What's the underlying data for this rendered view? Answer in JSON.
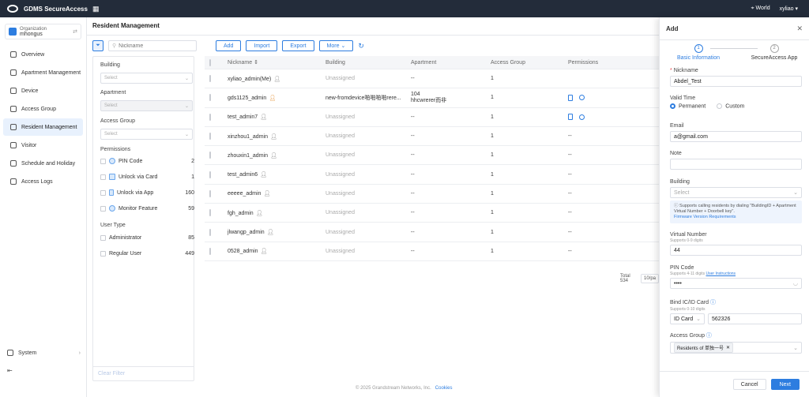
{
  "topbar": {
    "title": "GDMS SecureAccess",
    "region": "World",
    "user": "xyliao"
  },
  "sidebar": {
    "org_label": "Organization",
    "org_name": "mhongus",
    "items": [
      {
        "label": "Overview"
      },
      {
        "label": "Apartment Management"
      },
      {
        "label": "Device"
      },
      {
        "label": "Access Group"
      },
      {
        "label": "Resident Management"
      },
      {
        "label": "Visitor"
      },
      {
        "label": "Schedule and Holiday"
      },
      {
        "label": "Access Logs"
      }
    ],
    "system": "System"
  },
  "main": {
    "title": "Resident Management",
    "search_placeholder": "Nickname",
    "add": "Add",
    "import": "Import",
    "export": "Export",
    "more": "More"
  },
  "filter": {
    "building_label": "Building",
    "building_ph": "Select",
    "apartment_label": "Apartment",
    "apartment_ph": "Select",
    "access_group_label": "Access Group",
    "access_group_ph": "Select",
    "permissions_label": "Permissions",
    "permissions": [
      {
        "label": "PIN Code",
        "count": "2"
      },
      {
        "label": "Unlock via Card",
        "count": "1"
      },
      {
        "label": "Unlock via App",
        "count": "160"
      },
      {
        "label": "Monitor Feature",
        "count": "59"
      }
    ],
    "user_type_label": "User Type",
    "user_types": [
      {
        "label": "Administrator",
        "count": "85"
      },
      {
        "label": "Regular User",
        "count": "449"
      }
    ],
    "clear": "Clear Filter"
  },
  "table": {
    "headers": [
      "Nickname",
      "Building",
      "Apartment",
      "Access Group",
      "Permissions"
    ],
    "rows": [
      {
        "nick": "xyliao_admin(Me)",
        "building": "Unassigned",
        "apt": "--",
        "ag": "1",
        "perm": ""
      },
      {
        "nick": "gds1125_admin",
        "building": "new-fromdevice啪啪啪啪rere...",
        "apt": "104",
        "apt2": "hhcwrerer而非",
        "ag": "1",
        "perm": "icons"
      },
      {
        "nick": "test_admin7",
        "building": "Unassigned",
        "apt": "--",
        "ag": "1",
        "perm": "icons"
      },
      {
        "nick": "xinzhou1_admin",
        "building": "Unassigned",
        "apt": "--",
        "ag": "1",
        "perm": "--"
      },
      {
        "nick": "zhouxin1_admin",
        "building": "Unassigned",
        "apt": "--",
        "ag": "1",
        "perm": "--"
      },
      {
        "nick": "test_admin6",
        "building": "Unassigned",
        "apt": "--",
        "ag": "1",
        "perm": "--"
      },
      {
        "nick": "eeeee_admin",
        "building": "Unassigned",
        "apt": "--",
        "ag": "1",
        "perm": "--"
      },
      {
        "nick": "fgh_admin",
        "building": "Unassigned",
        "apt": "--",
        "ag": "1",
        "perm": "--"
      },
      {
        "nick": "jlwangp_admin",
        "building": "Unassigned",
        "apt": "--",
        "ag": "1",
        "perm": "--"
      },
      {
        "nick": "0528_admin",
        "building": "Unassigned",
        "apt": "--",
        "ag": "1",
        "perm": "--"
      }
    ],
    "total": "Total 534",
    "page_size": "10/pa"
  },
  "footer": {
    "copyright": "© 2025 Grandstream Networks, Inc.",
    "cookies": "Cookies"
  },
  "drawer": {
    "title": "Add",
    "step1": "Basic Information",
    "step2": "SecureAccess App",
    "nickname_label": "Nickname",
    "nickname": "Abdel_Test",
    "valid_label": "Valid Time",
    "permanent": "Permanent",
    "custom": "Custom",
    "email_label": "Email",
    "email": "a@gmail.com",
    "note_label": "Note",
    "building_label": "Building",
    "building_ph": "Select",
    "tip": "Supports calling residents by dialing \"BuildingID + Apartment Virtual Number + Doorbell key\".",
    "tip_link": "Firmware Version Requirements",
    "vn_label": "Virtual Number",
    "vn_sub": "Supports 0-9 digits",
    "vn": "44",
    "pin_label": "PIN Code",
    "pin_sub": "Supports 4-11 digits",
    "pin_link": "User Instructions",
    "pin": "••••",
    "card_label": "Bind IC/ID Card",
    "card_sub": "Supports 0-10 digits",
    "card_type": "ID Card",
    "card": "562326",
    "ag_label": "Access Group",
    "ag_tag": "Residents of 单独一号",
    "cancel": "Cancel",
    "next": "Next"
  }
}
